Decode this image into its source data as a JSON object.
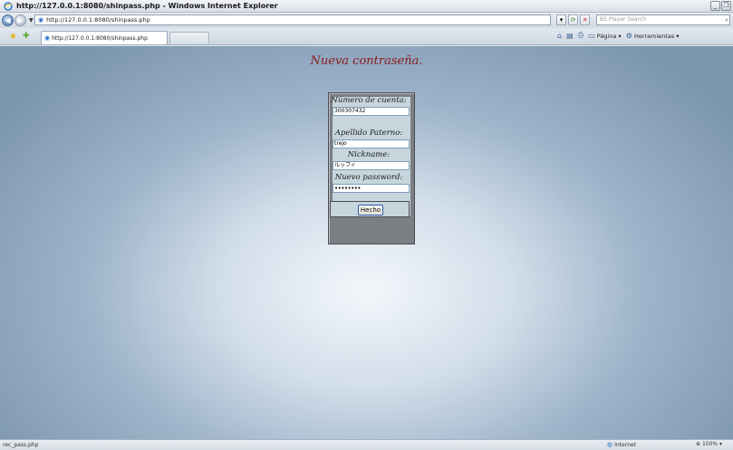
{
  "window": {
    "title": "http://127.0.0.1:8080/shinpass.php - Windows Internet Explorer",
    "minimize": "_",
    "restore": "❐"
  },
  "address": {
    "url": "http://127.0.0.1:8080/shinpass.php",
    "search_placeholder": "B5 Player Search"
  },
  "tab": {
    "title": "http://127.0.0.1:8080/shinpass.php"
  },
  "command_bar": {
    "page_label": "Página",
    "tools_label": "Herramientas"
  },
  "page": {
    "heading": "Nueva contraseña.",
    "form": {
      "account_label": "Número de cuenta:",
      "account_value": "300307432",
      "surname_label": "Apellido Paterno:",
      "surname_value": "trejo",
      "nickname_label": "Nickname:",
      "nickname_value": "ルッフィ",
      "password_label": "Nuevo password:",
      "password_value": "••••••••",
      "submit_label": "Hecho"
    }
  },
  "status": {
    "text": "rec_pass.php",
    "zone": "Internet",
    "zoom": "100%"
  },
  "colors": {
    "heading": "#8b1a1a",
    "form_panel": "#c7d6dd",
    "form_border": "#7b7f84"
  }
}
